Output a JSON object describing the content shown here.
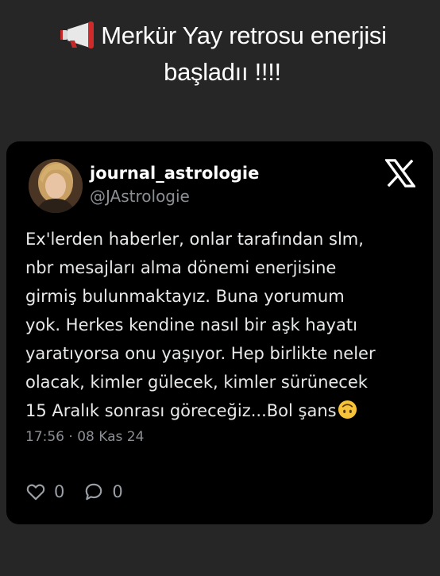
{
  "headline": {
    "line1": "Merkür Yay retrosu enerjisi",
    "line2": "başladıı !!!!"
  },
  "tweet": {
    "display_name": "journal_astrologie",
    "handle": "@JAstrologie",
    "text_lines": [
      "Ex'lerden haberler, onlar tarafından slm,",
      "nbr mesajları alma dönemi enerjisine",
      "girmiş bulunmaktayız. Buna yorumum",
      "yok. Herkes kendine nasıl bir aşk hayatı",
      "yaratıyorsa onu yaşıyor. Hep birlikte neler",
      "olacak, kimler gülecek, kimler sürünecek",
      "15 Aralık sonrası göreceğiz...Bol şans"
    ],
    "timestamp": "17:56 · 08 Kas 24",
    "likes": "0",
    "replies": "0"
  },
  "icons": {
    "headline": "megaphone-icon",
    "brand": "x-logo-icon",
    "emoji": "upside-down-face-emoji",
    "like": "heart-icon",
    "reply": "reply-bubble-icon"
  },
  "colors": {
    "story_background": "#262626",
    "card_background": "#000000",
    "secondary_text": "#8b8f94"
  }
}
